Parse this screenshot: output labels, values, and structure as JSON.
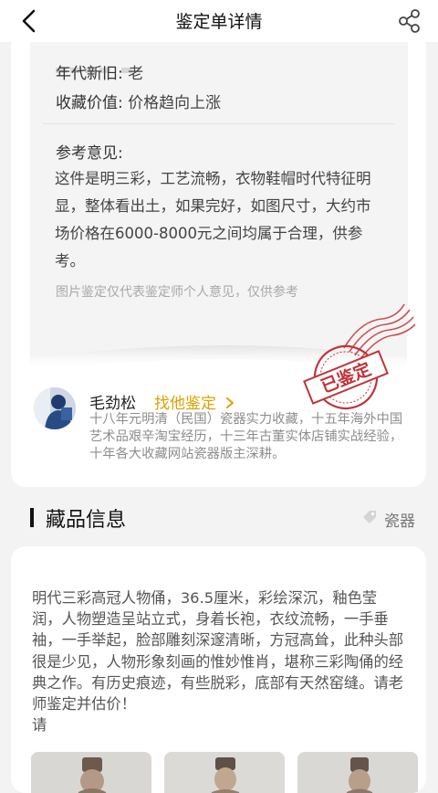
{
  "header": {
    "title": "鉴定单详情",
    "back_icon": "chevron-left-icon",
    "share_icon": "share-icon"
  },
  "appraisal": {
    "fields": [
      {
        "label": "年代新旧:",
        "value": "老"
      },
      {
        "label": "收藏价值:",
        "value": "价格趋向上涨"
      }
    ],
    "opinion_label": "参考意见:",
    "opinion": "这件是明三彩，工艺流畅，衣物鞋帽时代特征明显，整体看出土，如果完好，如图尺寸，大约市场价格在6000-8000元之间均属于合理，供参考。",
    "disclaimer": "图片鉴定仅代表鉴定师个人意见，仅供参考",
    "stamp_text": "已鉴定",
    "stamp_color": "#c0343a"
  },
  "expert": {
    "name": "毛劲松",
    "link": "找他鉴定",
    "link_icon": "chevron-right-icon",
    "bio": "十八年元明清（民国）瓷器实力收藏，十五年海外中国艺术品艰辛淘宝经历，十三年古董实体店铺实战经验，十年各大收藏网站瓷器版主深耕。",
    "accent": "#e0a000"
  },
  "item": {
    "section_title": "藏品信息",
    "category": "瓷器",
    "category_icon": "tag-icon",
    "description": "明代三彩高冠人物俑，36.5厘米，彩绘深沉，釉色莹润，人物塑造呈站立式，身着长袍，衣纹流畅，一手垂袖，一手举起，脸部雕刻深邃清晰，方冠高耸，此种头部很是少见，人物形象刻画的惟妙惟肖，堪称三彩陶俑的经典之作。有历史痕迹，有些脱彩，底部有天然窑缝。请老师鉴定并估价！\n请",
    "photos": [
      "item-photo-1",
      "item-photo-2",
      "item-photo-3"
    ]
  }
}
